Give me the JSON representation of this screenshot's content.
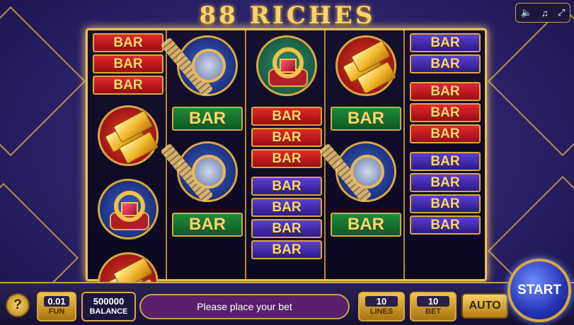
{
  "game": {
    "title": "88 RICHES"
  },
  "top_controls": {
    "icons": [
      "speaker-icon",
      "music-note-icon",
      "fullscreen-icon"
    ]
  },
  "reels": {
    "bar_label": "BAR",
    "columns": [
      {
        "symbols": [
          {
            "kind": "bar",
            "color": "red"
          },
          {
            "kind": "bar",
            "color": "red"
          },
          {
            "kind": "bar",
            "color": "red"
          },
          {
            "kind": "gold-bars",
            "disc": "red"
          },
          {
            "kind": "ring",
            "disc": "blue"
          },
          {
            "kind": "gold-bars",
            "disc": "red"
          }
        ]
      },
      {
        "symbols": [
          {
            "kind": "watch",
            "disc": "blue"
          },
          {
            "kind": "bar",
            "color": "green"
          },
          {
            "kind": "watch",
            "disc": "blue"
          },
          {
            "kind": "bar",
            "color": "green"
          }
        ]
      },
      {
        "symbols": [
          {
            "kind": "ring",
            "disc": "green"
          },
          {
            "kind": "bar",
            "color": "red"
          },
          {
            "kind": "bar",
            "color": "red"
          },
          {
            "kind": "bar",
            "color": "red"
          },
          {
            "kind": "bar",
            "color": "blue"
          },
          {
            "kind": "bar",
            "color": "blue"
          },
          {
            "kind": "bar",
            "color": "blue"
          },
          {
            "kind": "bar",
            "color": "blue"
          }
        ]
      },
      {
        "symbols": [
          {
            "kind": "gold-bars",
            "disc": "red"
          },
          {
            "kind": "bar",
            "color": "green"
          },
          {
            "kind": "watch",
            "disc": "blue"
          },
          {
            "kind": "bar",
            "color": "green"
          }
        ]
      },
      {
        "symbols": [
          {
            "kind": "bar",
            "color": "blue"
          },
          {
            "kind": "bar",
            "color": "blue"
          },
          {
            "kind": "bar",
            "color": "red"
          },
          {
            "kind": "bar",
            "color": "red"
          },
          {
            "kind": "bar",
            "color": "red"
          },
          {
            "kind": "bar",
            "color": "blue"
          },
          {
            "kind": "bar",
            "color": "blue"
          },
          {
            "kind": "bar",
            "color": "blue"
          },
          {
            "kind": "bar",
            "color": "blue"
          }
        ]
      }
    ]
  },
  "bottom_bar": {
    "help_label": "?",
    "coin": {
      "value": "0.01",
      "label": "FUN"
    },
    "balance": {
      "value": "500000",
      "label": "BALANCE"
    },
    "status_message": "Please place your bet",
    "lines": {
      "value": "10",
      "label": "LINES"
    },
    "bet": {
      "value": "10",
      "label": "BET"
    },
    "auto_label": "AUTO",
    "start_label": "START"
  },
  "colors": {
    "gold": "#d8a840",
    "background": "#2b2168",
    "start_button": "#2533b3"
  }
}
